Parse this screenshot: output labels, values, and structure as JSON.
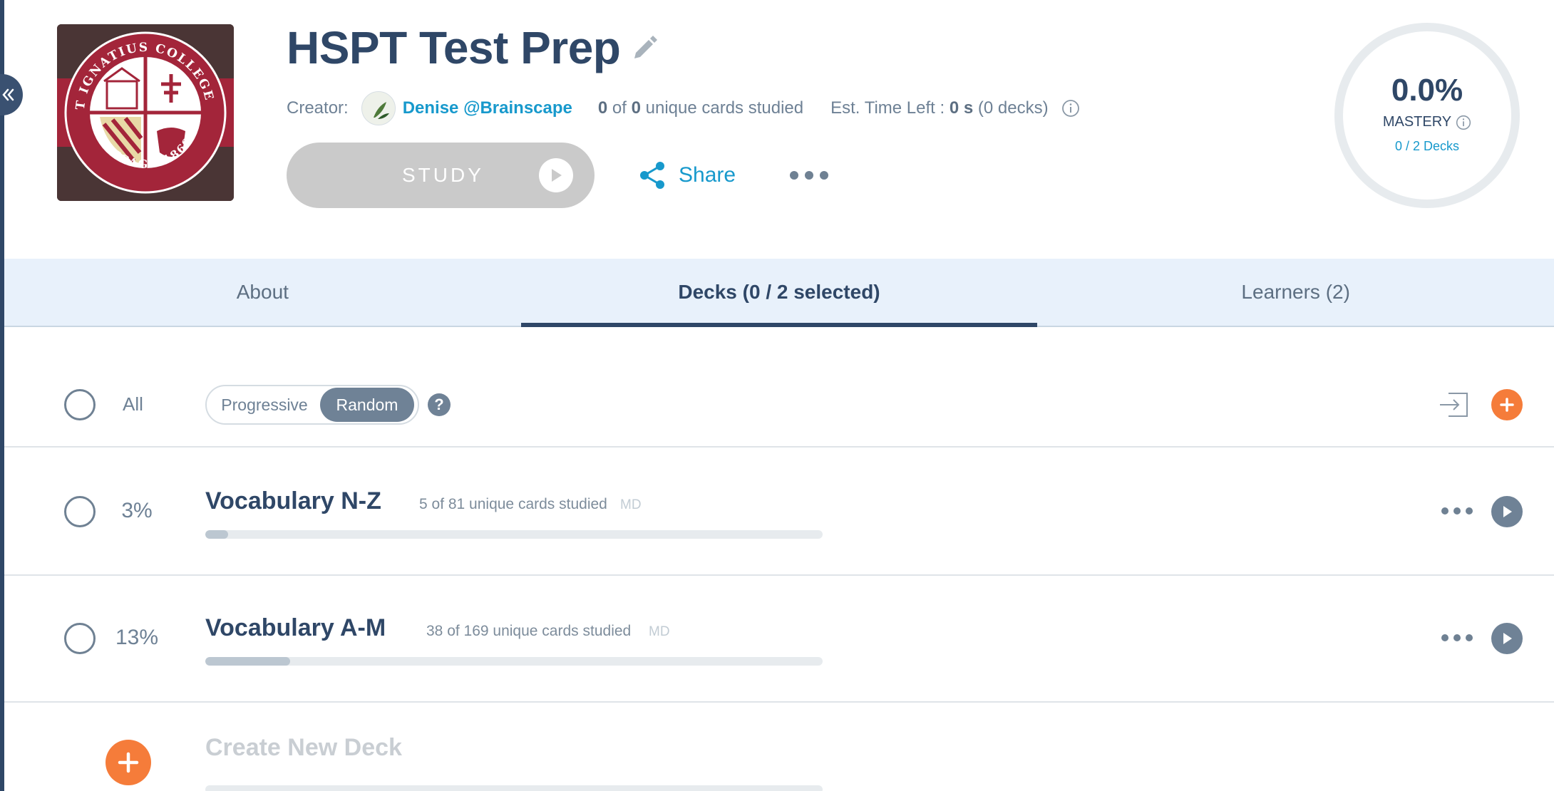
{
  "pack": {
    "title": "HSPT Test Prep",
    "logo_text_top": "SAINT IGNATIUS COLLEGE PREP",
    "logo_text_bottom": "CHICAGO 1869",
    "logo_monogram": "A M D G"
  },
  "creator": {
    "label": "Creator:",
    "name": "Denise @Brainscape"
  },
  "stats": {
    "studied_count": "0",
    "of": "of",
    "total_count": "0",
    "studied_suffix": "unique cards studied",
    "est_label": "Est. Time Left :",
    "est_value": "0 s",
    "est_decks": "(0 decks)"
  },
  "actions": {
    "study_label": "STUDY",
    "share_label": "Share"
  },
  "mastery": {
    "value": "0.0%",
    "label": "MASTERY",
    "decks": "0 / 2 Decks",
    "fraction": 0.0
  },
  "tabs": [
    {
      "label": "About",
      "active": false
    },
    {
      "label": "Decks (0 / 2 selected)",
      "active": true
    },
    {
      "label": "Learners (2)",
      "active": false
    }
  ],
  "controls": {
    "all_label": "All",
    "mode_options": [
      "Progressive",
      "Random"
    ],
    "mode_selected": "Random",
    "help_glyph": "?"
  },
  "decks": [
    {
      "pct": "3%",
      "name": "Vocabulary N-Z",
      "meta": "5 of 81 unique cards studied",
      "tag": "MD",
      "progress": 0.037
    },
    {
      "pct": "13%",
      "name": "Vocabulary A-M",
      "meta": "38 of 169 unique cards studied",
      "tag": "MD",
      "progress": 0.137
    }
  ],
  "create": {
    "label": "Create New Deck"
  },
  "colors": {
    "primary": "#2f4767",
    "link": "#1799cc",
    "accent_orange": "#f57c3a",
    "tab_bg": "#e8f1fb",
    "muted": "#6f8296",
    "study_disabled": "#cacaca"
  }
}
